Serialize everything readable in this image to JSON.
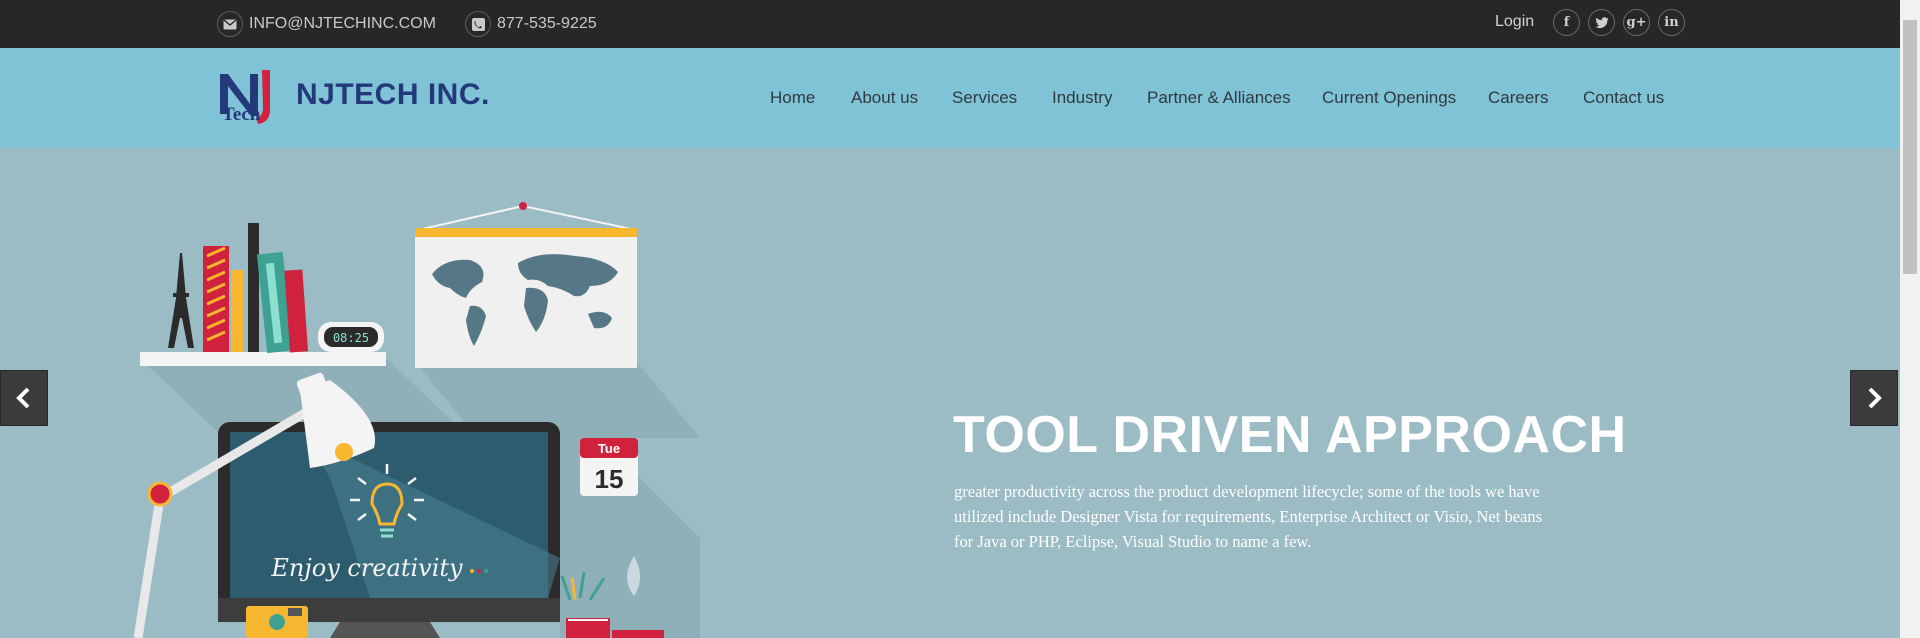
{
  "topbar": {
    "email": "INFO@NJTECHINC.COM",
    "phone": "877-535-9225",
    "login": "Login",
    "socials": [
      {
        "icon": "facebook-icon",
        "glyph": "f"
      },
      {
        "icon": "twitter-icon",
        "glyph": "t"
      },
      {
        "icon": "google-plus-icon",
        "glyph": "g+"
      },
      {
        "icon": "linkedin-icon",
        "glyph": "in"
      }
    ]
  },
  "brand": {
    "name": "NJTECH INC.",
    "logo_small": "Tech",
    "primary_color": "#24397a",
    "accent_color": "#d0213d"
  },
  "nav": {
    "items": [
      "Home",
      "About us",
      "Services",
      "Industry",
      "Partner & Alliances",
      "Current Openings",
      "Careers",
      "Contact us"
    ]
  },
  "hero": {
    "title": "TOOL DRIVEN APPROACH",
    "body": "greater productivity across the product development lifecycle; some of the tools we have utilized include Designer Vista for requirements, Enterprise Architect or Visio, Net beans for Java or PHP, Eclipse, Visual Studio to name a few.",
    "clock": "08:25",
    "calendar_day": "Tue",
    "calendar_date": "15",
    "screen_text": "Enjoy creativity",
    "background": "#9bbcc4"
  },
  "colors": {
    "topbar": "#272727",
    "header": "#80c2d6"
  }
}
